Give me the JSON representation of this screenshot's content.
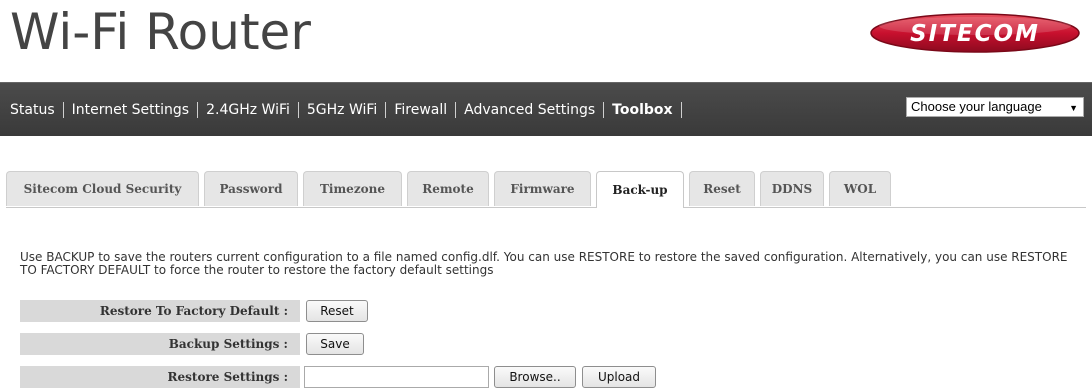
{
  "header": {
    "title": "Wi-Fi Router",
    "brand": "SITECOM"
  },
  "nav": {
    "items": [
      "Status",
      "Internet Settings",
      "2.4GHz WiFi",
      "5GHz WiFi",
      "Firewall",
      "Advanced Settings",
      "Toolbox"
    ],
    "active": "Toolbox"
  },
  "language": {
    "selected": "Choose your language"
  },
  "tabs": {
    "items": [
      "Sitecom Cloud Security",
      "Password",
      "Timezone",
      "Remote",
      "Firmware",
      "Back-up",
      "Reset",
      "DDNS",
      "WOL"
    ],
    "active": "Back-up"
  },
  "description": "Use BACKUP to save the routers current configuration to a file named config.dlf. You can use RESTORE to restore the saved configuration. Alternatively, you can use RESTORE TO FACTORY DEFAULT to force the router to restore the factory default settings",
  "form": {
    "factory_label": "Restore To Factory Default :",
    "factory_button": "Reset",
    "backup_label": "Backup Settings :",
    "backup_button": "Save",
    "restore_label": "Restore Settings :",
    "restore_file_value": "",
    "browse_button": "Browse..",
    "upload_button": "Upload"
  },
  "colors": {
    "nav_bg": "#444444",
    "brand_red": "#c8102e",
    "row_bg": "#d9d9d9"
  }
}
